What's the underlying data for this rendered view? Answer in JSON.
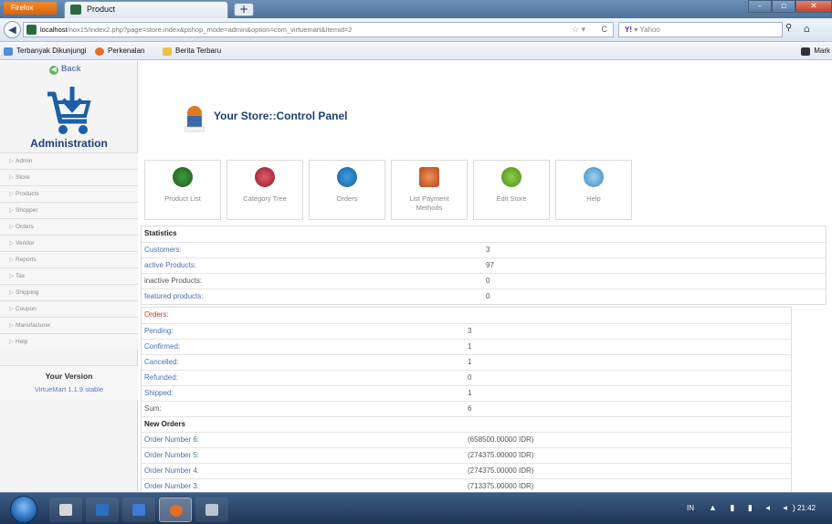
{
  "browser": {
    "firefox_label": "Firefox",
    "tab_title": "Product",
    "new_tab": "+",
    "url_host": "localhost",
    "url_rest": "/nox15/index2.php?page=store.index&pshop_mode=admin&option=com_virtuemart&Itemid=2",
    "search_placeholder": "Yahoo",
    "bookmarks": [
      "Terbanyak Dikunjungi",
      "Perkenalan",
      "Berita Terbaru"
    ],
    "bookmarks_right": "Mark"
  },
  "sidebar": {
    "back_label": "Back",
    "title": "Administration",
    "menu": [
      "Admin",
      "Store",
      "Products",
      "Shopper",
      "Orders",
      "Vendor",
      "Reports",
      "Tax",
      "Shipping",
      "Coupon",
      "Manufacturer",
      "Help"
    ],
    "version_title": "Your Version",
    "version_value": "VirtueMart 1.1.9 stable"
  },
  "main": {
    "store_title": "Your Store::Control Panel",
    "control_buttons": [
      "Product List",
      "Category Tree",
      "Orders",
      "List Payment Methods",
      "Edit Store",
      "Help"
    ]
  },
  "statistics": {
    "header": "Statistics",
    "rows": [
      {
        "label": "Customers:",
        "value": "3"
      },
      {
        "label": "active Products:",
        "value": "97"
      },
      {
        "label": "inactive Products:",
        "value": "0"
      },
      {
        "label": "featured products:",
        "value": "0"
      }
    ]
  },
  "orders": {
    "header": "Orders:",
    "rows": [
      {
        "label": "Pending:",
        "value": "3"
      },
      {
        "label": "Confirmed:",
        "value": "1"
      },
      {
        "label": "Cancelled:",
        "value": "1"
      },
      {
        "label": "Refunded:",
        "value": "0"
      },
      {
        "label": "Shipped:",
        "value": "1"
      },
      {
        "label": "Sum:",
        "value": "6"
      }
    ],
    "new_orders_header": "New Orders",
    "new_orders": [
      {
        "label": "Order Number 6:",
        "value": "(658500.00000 IDR)"
      },
      {
        "label": "Order Number 5:",
        "value": "(274375.00000 IDR)"
      },
      {
        "label": "Order Number 4:",
        "value": "(274375.00000 IDR)"
      },
      {
        "label": "Order Number 3:",
        "value": "(713375.00000 IDR)"
      }
    ]
  },
  "taskbar": {
    "lang": "IN",
    "clock": "21:42"
  }
}
